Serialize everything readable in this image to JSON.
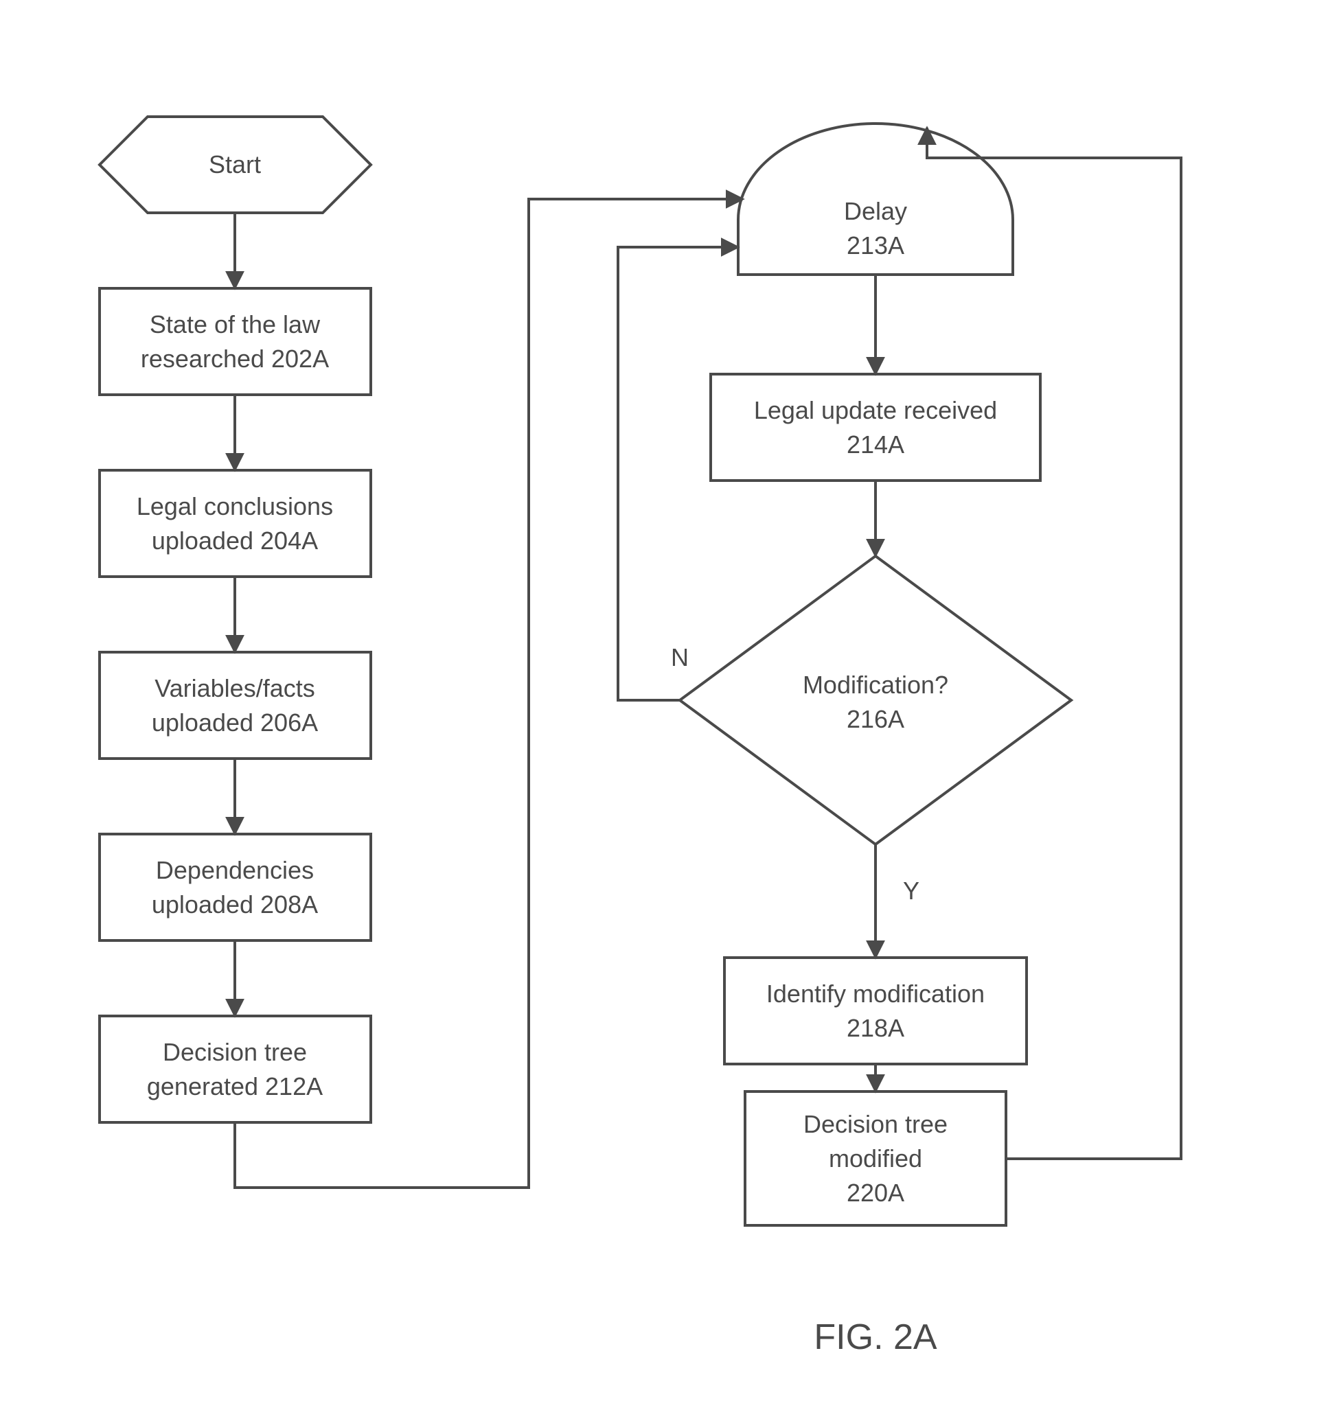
{
  "nodes": {
    "start": {
      "line1": "Start"
    },
    "research": {
      "line1": "State of the law",
      "line2": "researched  202A"
    },
    "conclusions": {
      "line1": "Legal conclusions",
      "line2": "uploaded  204A"
    },
    "variables": {
      "line1": "Variables/facts",
      "line2": "uploaded  206A"
    },
    "dependencies": {
      "line1": "Dependencies",
      "line2": "uploaded  208A"
    },
    "tree_gen": {
      "line1": "Decision tree",
      "line2": "generated  212A"
    },
    "delay": {
      "line1": "Delay",
      "line2": "213A"
    },
    "update": {
      "line1": "Legal update received",
      "line2": "214A"
    },
    "decision": {
      "line1": "Modification?",
      "line2": "216A"
    },
    "identify": {
      "line1": "Identify modification",
      "line2": "218A"
    },
    "tree_mod": {
      "line1": "Decision tree",
      "line2": "modified",
      "line3": "220A"
    }
  },
  "edge_labels": {
    "no": "N",
    "yes": "Y"
  },
  "caption": "FIG. 2A"
}
